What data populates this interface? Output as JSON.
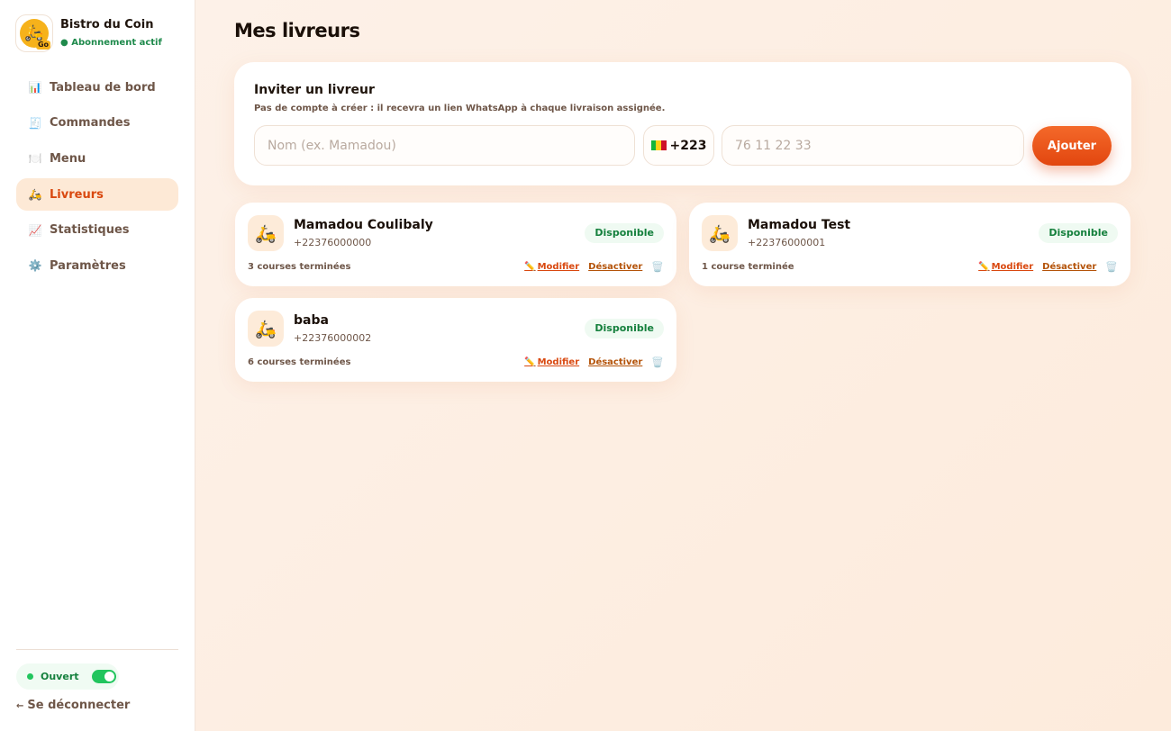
{
  "brand": {
    "name": "Bistro du Coin",
    "subscription": "● Abonnement actif",
    "logo_text": "Go"
  },
  "nav": [
    {
      "icon": "📊",
      "label": "Tableau de bord",
      "active": false
    },
    {
      "icon": "🧾",
      "label": "Commandes",
      "active": false
    },
    {
      "icon": "🍽️",
      "label": "Menu",
      "active": false
    },
    {
      "icon": "🛵",
      "label": "Livreurs",
      "active": true
    },
    {
      "icon": "📈",
      "label": "Statistiques",
      "active": false
    },
    {
      "icon": "⚙️",
      "label": "Paramètres",
      "active": false
    }
  ],
  "status": {
    "label": "Ouvert",
    "on": true
  },
  "logout": {
    "arrow": "←",
    "label": "Se déconnecter"
  },
  "page": {
    "title": "Mes livreurs"
  },
  "invite": {
    "title": "Inviter un livreur",
    "subtitle": "Pas de compte à créer : il recevra un lien WhatsApp à chaque livraison assignée.",
    "name_placeholder": "Nom (ex. Mamadou)",
    "country_code": "+223",
    "phone_placeholder": "76 11 22 33",
    "add_label": "Ajouter"
  },
  "courier_actions": {
    "edit": "Modifier",
    "deactivate": "Désactiver"
  },
  "couriers": [
    {
      "name": "Mamadou Coulibaly",
      "phone": "+22376000000",
      "status": "Disponible",
      "count": "3 courses terminées"
    },
    {
      "name": "Mamadou Test",
      "phone": "+22376000001",
      "status": "Disponible",
      "count": "1 course terminée"
    },
    {
      "name": "baba",
      "phone": "+22376000002",
      "status": "Disponible",
      "count": "6 courses terminées"
    }
  ],
  "colors": {
    "accent": "#e2460f",
    "active_bg": "#fde9d6",
    "success": "#15803d"
  }
}
